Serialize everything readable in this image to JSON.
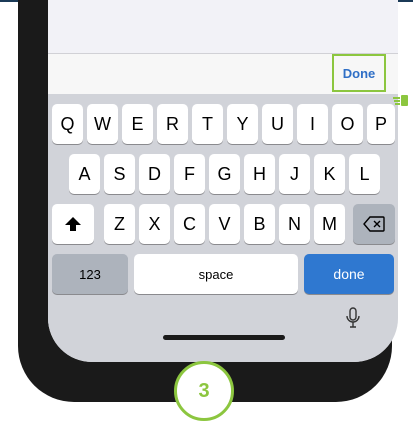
{
  "toolbar": {
    "done_label": "Done"
  },
  "keyboard": {
    "row1": [
      "Q",
      "W",
      "E",
      "R",
      "T",
      "Y",
      "U",
      "I",
      "O",
      "P"
    ],
    "row2": [
      "A",
      "S",
      "D",
      "F",
      "G",
      "H",
      "J",
      "K",
      "L"
    ],
    "row3": [
      "Z",
      "X",
      "C",
      "V",
      "B",
      "N",
      "M"
    ],
    "numbers_label": "123",
    "space_label": "space",
    "return_label": "done"
  },
  "step": {
    "number": "3"
  },
  "colors": {
    "highlight": "#8cc63f",
    "accent_blue": "#2f78d0"
  },
  "icons": {
    "shift": "shift-icon",
    "delete": "backspace-icon",
    "mic": "microphone-icon",
    "pointer": "pointing-hand-icon"
  }
}
